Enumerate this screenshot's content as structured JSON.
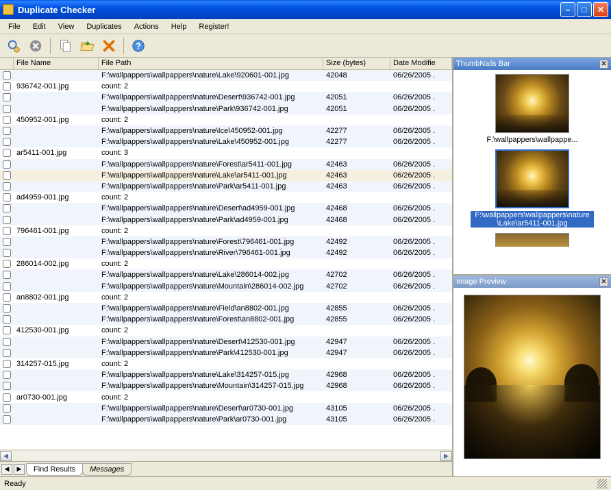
{
  "window": {
    "title": "Duplicate Checker"
  },
  "menu": {
    "file": "File",
    "edit": "Edit",
    "view": "View",
    "duplicates": "Duplicates",
    "actions": "Actions",
    "help": "Help",
    "register": "Register!"
  },
  "columns": {
    "name": "File Name",
    "path": "File Path",
    "size": "Size (bytes)",
    "date": "Date Modifie"
  },
  "rows": [
    {
      "type": "file",
      "name": "",
      "path": "F:\\wallpappers\\wallpappers\\nature\\Lake\\920601-001.jpg",
      "size": "42048",
      "date": "06/26/2005 .",
      "stripe": "b"
    },
    {
      "type": "group",
      "name": "936742-001.jpg",
      "path": "count: 2",
      "stripe": "a"
    },
    {
      "type": "file",
      "name": "",
      "path": "F:\\wallpappers\\wallpappers\\nature\\Desert\\936742-001.jpg",
      "size": "42051",
      "date": "06/26/2005 .",
      "stripe": "b"
    },
    {
      "type": "file",
      "name": "",
      "path": "F:\\wallpappers\\wallpappers\\nature\\Park\\936742-001.jpg",
      "size": "42051",
      "date": "06/26/2005 .",
      "stripe": "b"
    },
    {
      "type": "group",
      "name": "450952-001.jpg",
      "path": "count: 2",
      "stripe": "a"
    },
    {
      "type": "file",
      "name": "",
      "path": "F:\\wallpappers\\wallpappers\\nature\\Ice\\450952-001.jpg",
      "size": "42277",
      "date": "06/26/2005 .",
      "stripe": "b"
    },
    {
      "type": "file",
      "name": "",
      "path": "F:\\wallpappers\\wallpappers\\nature\\Lake\\450952-001.jpg",
      "size": "42277",
      "date": "06/26/2005 .",
      "stripe": "b"
    },
    {
      "type": "group",
      "name": "ar5411-001.jpg",
      "path": "count: 3",
      "stripe": "a"
    },
    {
      "type": "file",
      "name": "",
      "path": "F:\\wallpappers\\wallpappers\\nature\\Forest\\ar5411-001.jpg",
      "size": "42463",
      "date": "06/26/2005 .",
      "stripe": "b"
    },
    {
      "type": "file",
      "name": "",
      "path": "F:\\wallpappers\\wallpappers\\nature\\Lake\\ar5411-001.jpg",
      "size": "42463",
      "date": "06/26/2005 .",
      "stripe": "b",
      "selected": true
    },
    {
      "type": "file",
      "name": "",
      "path": "F:\\wallpappers\\wallpappers\\nature\\Park\\ar5411-001.jpg",
      "size": "42463",
      "date": "06/26/2005 .",
      "stripe": "b"
    },
    {
      "type": "group",
      "name": "ad4959-001.jpg",
      "path": "count: 2",
      "stripe": "a"
    },
    {
      "type": "file",
      "name": "",
      "path": "F:\\wallpappers\\wallpappers\\nature\\Desert\\ad4959-001.jpg",
      "size": "42468",
      "date": "06/26/2005 .",
      "stripe": "b"
    },
    {
      "type": "file",
      "name": "",
      "path": "F:\\wallpappers\\wallpappers\\nature\\Park\\ad4959-001.jpg",
      "size": "42468",
      "date": "06/26/2005 .",
      "stripe": "b"
    },
    {
      "type": "group",
      "name": "796461-001.jpg",
      "path": "count: 2",
      "stripe": "a"
    },
    {
      "type": "file",
      "name": "",
      "path": "F:\\wallpappers\\wallpappers\\nature\\Forest\\796461-001.jpg",
      "size": "42492",
      "date": "06/26/2005 .",
      "stripe": "b"
    },
    {
      "type": "file",
      "name": "",
      "path": "F:\\wallpappers\\wallpappers\\nature\\River\\796461-001.jpg",
      "size": "42492",
      "date": "06/26/2005 .",
      "stripe": "b"
    },
    {
      "type": "group",
      "name": "286014-002.jpg",
      "path": "count: 2",
      "stripe": "a"
    },
    {
      "type": "file",
      "name": "",
      "path": "F:\\wallpappers\\wallpappers\\nature\\Lake\\286014-002.jpg",
      "size": "42702",
      "date": "06/26/2005 .",
      "stripe": "b"
    },
    {
      "type": "file",
      "name": "",
      "path": "F:\\wallpappers\\wallpappers\\nature\\Mountain\\286014-002.jpg",
      "size": "42702",
      "date": "06/26/2005 .",
      "stripe": "b"
    },
    {
      "type": "group",
      "name": "an8802-001.jpg",
      "path": "count: 2",
      "stripe": "a"
    },
    {
      "type": "file",
      "name": "",
      "path": "F:\\wallpappers\\wallpappers\\nature\\Field\\an8802-001.jpg",
      "size": "42855",
      "date": "06/26/2005 .",
      "stripe": "b"
    },
    {
      "type": "file",
      "name": "",
      "path": "F:\\wallpappers\\wallpappers\\nature\\Forest\\an8802-001.jpg",
      "size": "42855",
      "date": "06/26/2005 .",
      "stripe": "b"
    },
    {
      "type": "group",
      "name": "412530-001.jpg",
      "path": "count: 2",
      "stripe": "a"
    },
    {
      "type": "file",
      "name": "",
      "path": "F:\\wallpappers\\wallpappers\\nature\\Desert\\412530-001.jpg",
      "size": "42947",
      "date": "06/26/2005 .",
      "stripe": "b"
    },
    {
      "type": "file",
      "name": "",
      "path": "F:\\wallpappers\\wallpappers\\nature\\Park\\412530-001.jpg",
      "size": "42947",
      "date": "06/26/2005 .",
      "stripe": "b"
    },
    {
      "type": "group",
      "name": "314257-015.jpg",
      "path": "count: 2",
      "stripe": "a"
    },
    {
      "type": "file",
      "name": "",
      "path": "F:\\wallpappers\\wallpappers\\nature\\Lake\\314257-015.jpg",
      "size": "42968",
      "date": "06/26/2005 .",
      "stripe": "b"
    },
    {
      "type": "file",
      "name": "",
      "path": "F:\\wallpappers\\wallpappers\\nature\\Mountain\\314257-015.jpg",
      "size": "42968",
      "date": "06/26/2005 .",
      "stripe": "b"
    },
    {
      "type": "group",
      "name": "ar0730-001.jpg",
      "path": "count: 2",
      "stripe": "a"
    },
    {
      "type": "file",
      "name": "",
      "path": "F:\\wallpappers\\wallpappers\\nature\\Desert\\ar0730-001.jpg",
      "size": "43105",
      "date": "06/26/2005 .",
      "stripe": "b"
    },
    {
      "type": "file",
      "name": "",
      "path": "F:\\wallpappers\\wallpappers\\nature\\Park\\ar0730-001.jpg",
      "size": "43105",
      "date": "06/26/2005 .",
      "stripe": "b"
    }
  ],
  "tabs": {
    "findResults": "Find Results",
    "messages": "Messages"
  },
  "panels": {
    "thumbnails": {
      "title": "ThumbNails Bar",
      "items": [
        {
          "label": "F:\\wallpappers\\wallpappe...",
          "selected": false
        },
        {
          "label": "F:\\wallpappers\\wallpappers\\nature\\Lake\\ar5411-001.jpg",
          "selected": true
        }
      ]
    },
    "preview": {
      "title": "Image Preview"
    }
  },
  "status": {
    "text": "Ready"
  }
}
